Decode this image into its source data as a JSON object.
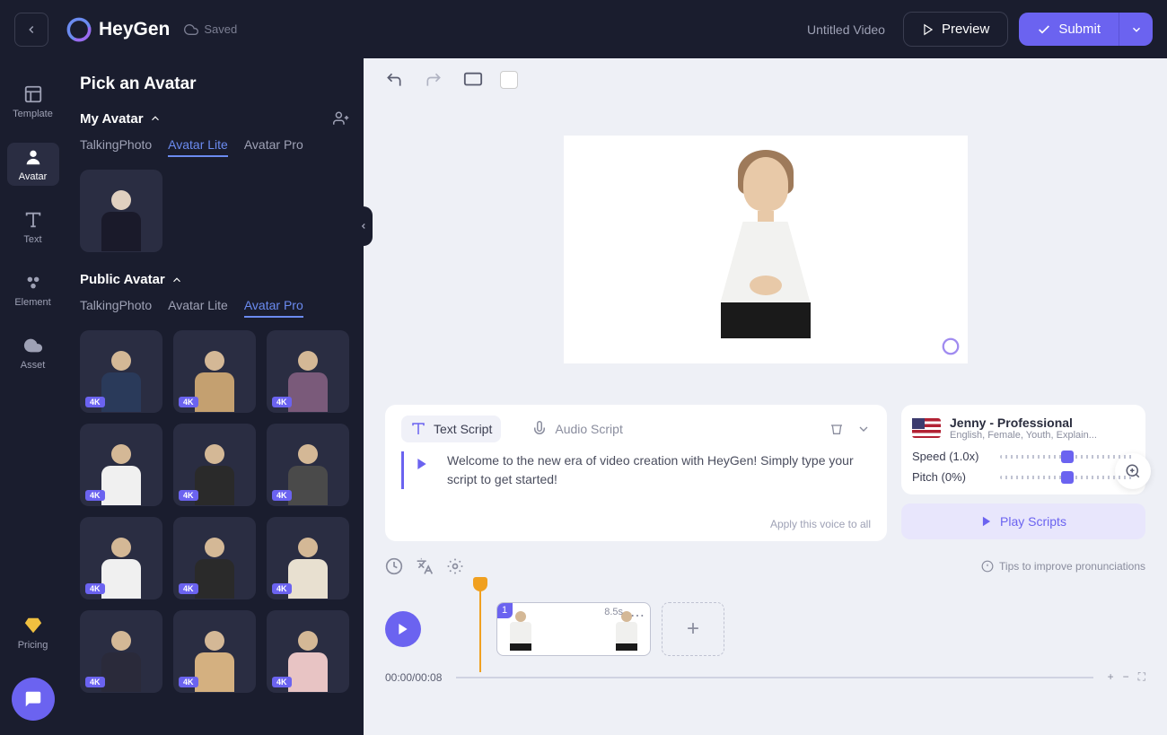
{
  "header": {
    "brand": "HeyGen",
    "saved": "Saved",
    "untitled": "Untitled Video",
    "preview": "Preview",
    "submit": "Submit"
  },
  "rail": {
    "template": "Template",
    "avatar": "Avatar",
    "text": "Text",
    "element": "Element",
    "asset": "Asset",
    "pricing": "Pricing"
  },
  "sidebar": {
    "title": "Pick an Avatar",
    "my_avatar": "My Avatar",
    "public_avatar": "Public Avatar",
    "tabs": {
      "talking_photo": "TalkingPhoto",
      "avatar_lite": "Avatar Lite",
      "avatar_pro": "Avatar Pro"
    },
    "badge_4k": "4K",
    "avatar_colors": [
      "#2a3a5a",
      "#c4a070",
      "#7a5a7a",
      "#f0f0f0",
      "#2a2a2a",
      "#4a4a4a",
      "#f0f0f0",
      "#2a2a2a",
      "#e8e0d0",
      "#2a2a3a",
      "#d4b080",
      "#e8c4c4"
    ]
  },
  "script": {
    "text_tab": "Text Script",
    "audio_tab": "Audio Script",
    "content": "Welcome to the new era of video creation with HeyGen! Simply type your script to get started!",
    "apply_all": "Apply this voice to all",
    "tips": "Tips to improve pronunciations"
  },
  "voice": {
    "name": "Jenny - Professional",
    "meta": "English, Female, Youth, Explain...",
    "speed_label": "Speed (1.0x)",
    "pitch_label": "Pitch (0%)",
    "play_scripts": "Play Scripts"
  },
  "timeline": {
    "clip_num": "1",
    "clip_dur": "8.5s",
    "time": "00:00/00:08"
  }
}
